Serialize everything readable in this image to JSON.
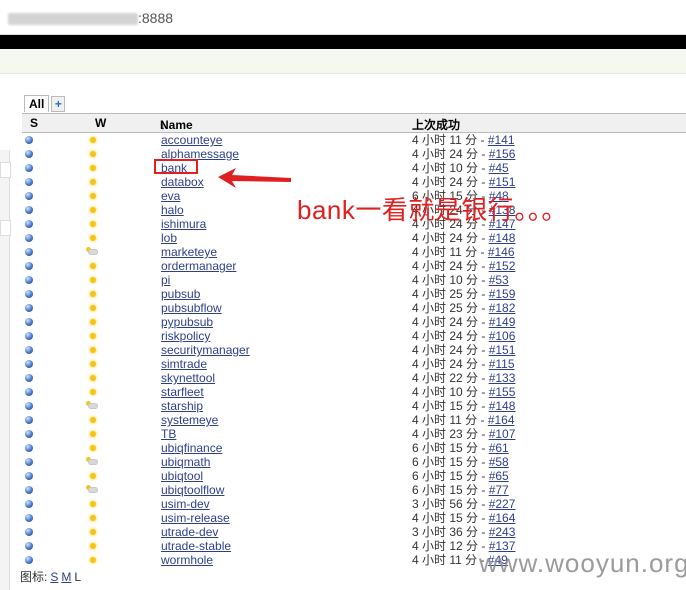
{
  "browser": {
    "url_visible": ":8888"
  },
  "tabs": {
    "all_label": "All",
    "add_label": "+"
  },
  "columns": {
    "s": "S",
    "w": "W",
    "name": "Name",
    "sort_arrow": "↓",
    "last_success": "上次成功"
  },
  "jobs": [
    {
      "name": "accounteye",
      "time": "4 小时 11 分 - ",
      "build": "#141",
      "weather": "sun"
    },
    {
      "name": "alphamessage",
      "time": "4 小时 24 分 - ",
      "build": "#156",
      "weather": "sun"
    },
    {
      "name": "bank",
      "time": "4 小时 10 分 - ",
      "build": "#45",
      "weather": "sun"
    },
    {
      "name": "databox",
      "time": "4 小时 24 分 - ",
      "build": "#151",
      "weather": "sun"
    },
    {
      "name": "eva",
      "time": "6 小时 15 分 - ",
      "build": "#48",
      "weather": "sun"
    },
    {
      "name": "halo",
      "time": "4 小时 24 分 - ",
      "build": "#138",
      "weather": "sun"
    },
    {
      "name": "ishimura",
      "time": "4 小时 24 分 - ",
      "build": "#147",
      "weather": "sun"
    },
    {
      "name": "lob",
      "time": "4 小时 24 分 - ",
      "build": "#148",
      "weather": "sun"
    },
    {
      "name": "marketeye",
      "time": "4 小时 11 分 - ",
      "build": "#146",
      "weather": "cloud"
    },
    {
      "name": "ordermanager",
      "time": "4 小时 24 分 - ",
      "build": "#152",
      "weather": "sun"
    },
    {
      "name": "pi",
      "time": "4 小时 10 分 - ",
      "build": "#53",
      "weather": "sun"
    },
    {
      "name": "pubsub",
      "time": "4 小时 25 分 - ",
      "build": "#159",
      "weather": "sun"
    },
    {
      "name": "pubsubflow",
      "time": "4 小时 25 分 - ",
      "build": "#182",
      "weather": "sun"
    },
    {
      "name": "pypubsub",
      "time": "4 小时 24 分 - ",
      "build": "#149",
      "weather": "sun"
    },
    {
      "name": "riskpolicy",
      "time": "4 小时 24 分 - ",
      "build": "#106",
      "weather": "sun"
    },
    {
      "name": "securitymanager",
      "time": "4 小时 24 分 - ",
      "build": "#151",
      "weather": "sun"
    },
    {
      "name": "simtrade",
      "time": "4 小时 24 分 - ",
      "build": "#115",
      "weather": "sun"
    },
    {
      "name": "skynettool",
      "time": "4 小时 22 分 - ",
      "build": "#133",
      "weather": "sun"
    },
    {
      "name": "starfleet",
      "time": "4 小时 10 分 - ",
      "build": "#155",
      "weather": "sun"
    },
    {
      "name": "starship",
      "time": "4 小时 15 分 - ",
      "build": "#148",
      "weather": "cloud"
    },
    {
      "name": "systemeye",
      "time": "4 小时 11 分 - ",
      "build": "#164",
      "weather": "sun"
    },
    {
      "name": "TB",
      "time": "4 小时 23 分 - ",
      "build": "#107",
      "weather": "sun"
    },
    {
      "name": "ubiqfinance",
      "time": "6 小时 15 分 - ",
      "build": "#61",
      "weather": "sun"
    },
    {
      "name": "ubiqmath",
      "time": "6 小时 15 分 - ",
      "build": "#58",
      "weather": "cloud"
    },
    {
      "name": "ubiqtool",
      "time": "6 小时 15 分 - ",
      "build": "#65",
      "weather": "sun"
    },
    {
      "name": "ubiqtoolflow",
      "time": "6 小时 15 分 - ",
      "build": "#77",
      "weather": "cloud"
    },
    {
      "name": "usim-dev",
      "time": "3 小时 56 分 - ",
      "build": "#227",
      "weather": "sun"
    },
    {
      "name": "usim-release",
      "time": "4 小时 15 分 - ",
      "build": "#164",
      "weather": "sun"
    },
    {
      "name": "utrade-dev",
      "time": "3 小时 36 分 - ",
      "build": "#243",
      "weather": "sun"
    },
    {
      "name": "utrade-stable",
      "time": "4 小时 12 分 - ",
      "build": "#137",
      "weather": "sun"
    },
    {
      "name": "wormhole",
      "time": "4 小时 11 分 - ",
      "build": "#49",
      "weather": "sun"
    }
  ],
  "annotation": {
    "text": "bank一看就是银行。。。"
  },
  "legend": {
    "label": "图标:",
    "s": "S",
    "m": "M",
    "l": "L"
  },
  "watermark": "www.wooyun.org",
  "colors": {
    "link": "#2d3f8c",
    "annotation": "#e02020",
    "status_ball": "#4a78c8",
    "weather_sun": "#f4c518"
  }
}
